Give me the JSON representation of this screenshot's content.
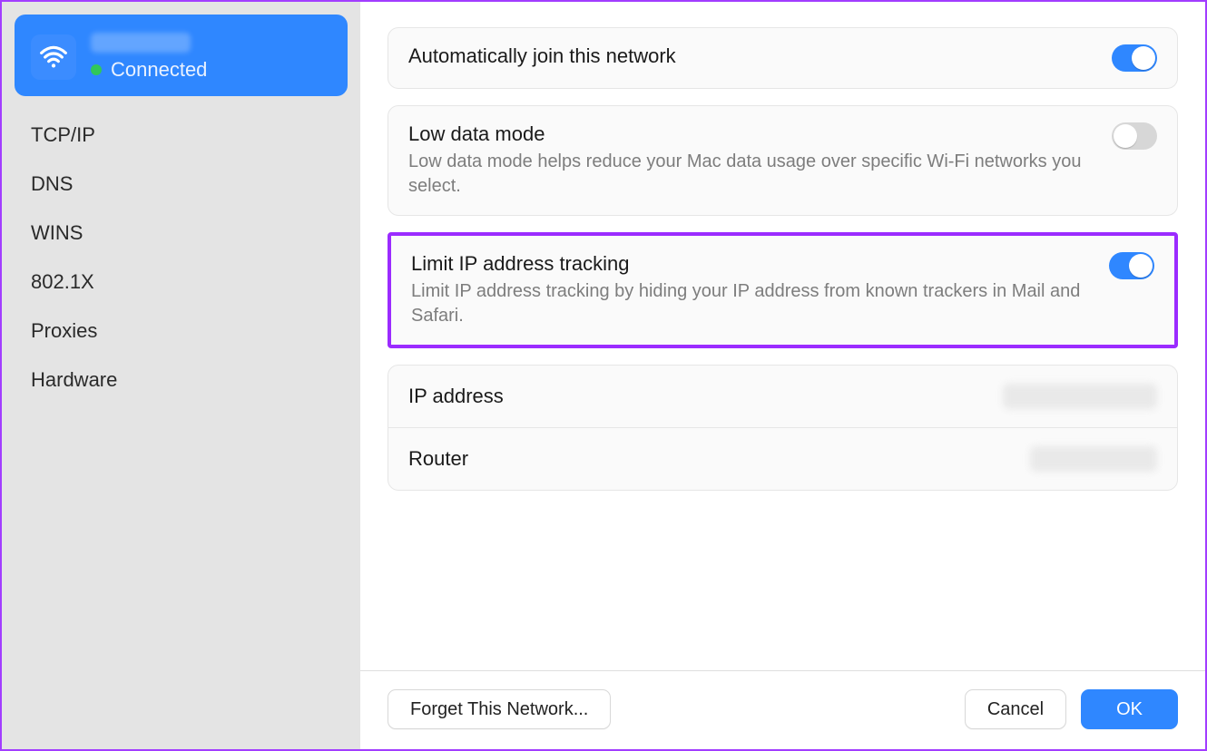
{
  "sidebar": {
    "network": {
      "status": "Connected"
    },
    "items": [
      {
        "label": "TCP/IP"
      },
      {
        "label": "DNS"
      },
      {
        "label": "WINS"
      },
      {
        "label": "802.1X"
      },
      {
        "label": "Proxies"
      },
      {
        "label": "Hardware"
      }
    ]
  },
  "settings": {
    "autoJoin": {
      "title": "Automatically join this network",
      "on": true
    },
    "lowData": {
      "title": "Low data mode",
      "sub": "Low data mode helps reduce your Mac data usage over specific Wi-Fi networks you select.",
      "on": false
    },
    "limitIp": {
      "title": "Limit IP address tracking",
      "sub": "Limit IP address tracking by hiding your IP address from known trackers in Mail and Safari.",
      "on": true
    },
    "ipAddress": {
      "label": "IP address"
    },
    "router": {
      "label": "Router"
    }
  },
  "footer": {
    "forget": "Forget This Network...",
    "cancel": "Cancel",
    "ok": "OK"
  }
}
